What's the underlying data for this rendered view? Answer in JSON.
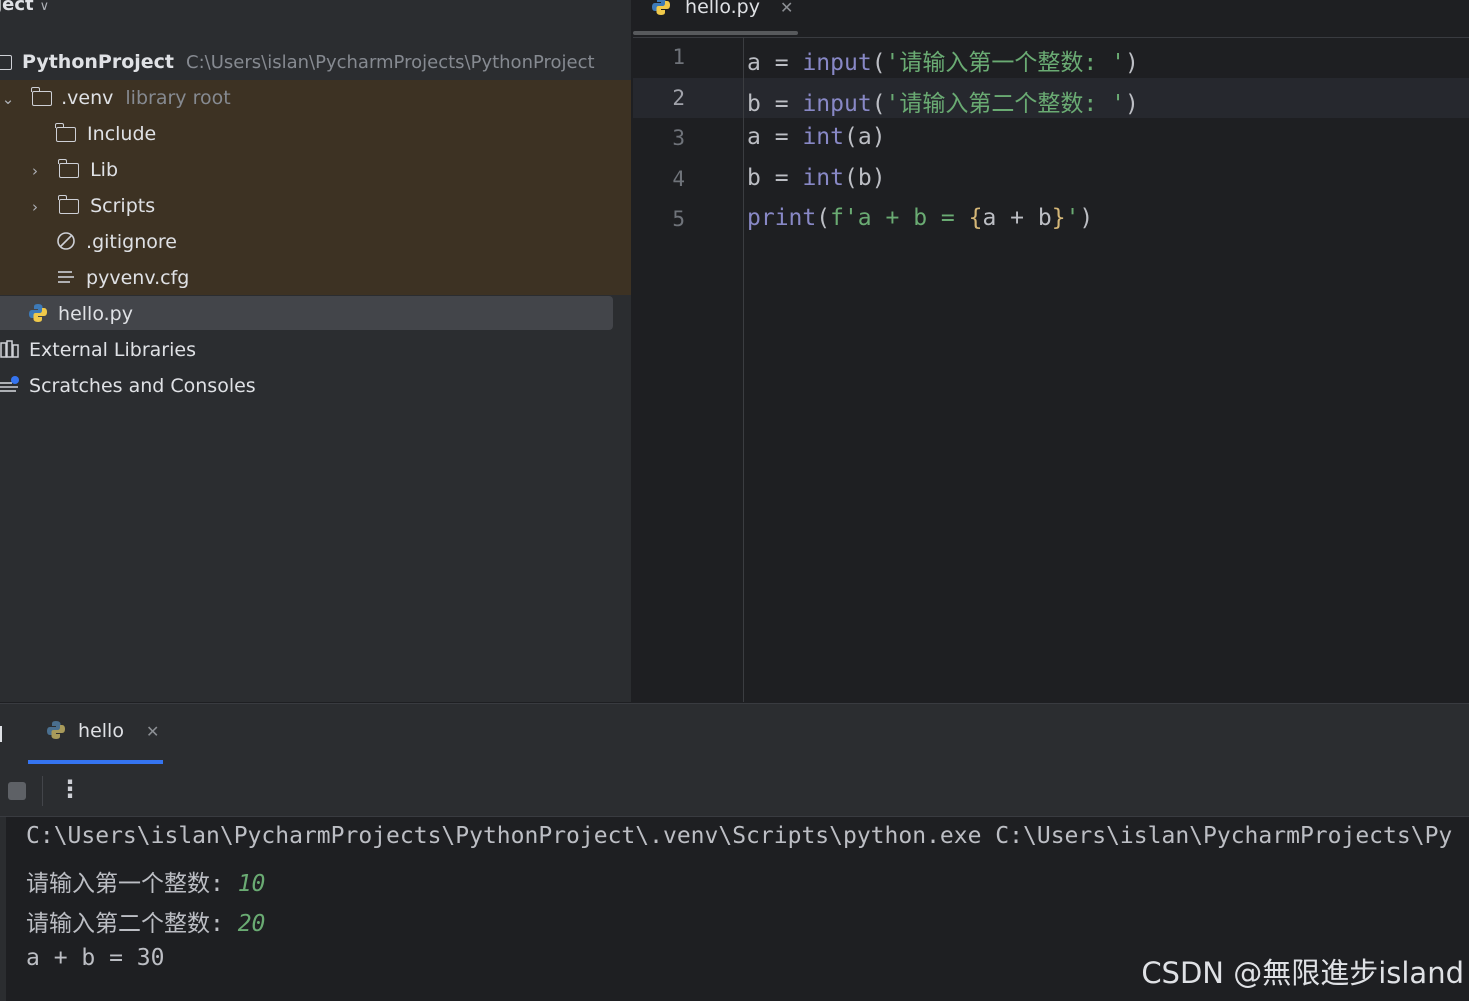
{
  "project_panel": {
    "header_label": "ject",
    "root": {
      "name": "PythonProject",
      "path": "C:\\Users\\islan\\PycharmProjects\\PythonProject"
    },
    "venv": {
      "name": ".venv",
      "note": "library root"
    },
    "items": {
      "include": "Include",
      "lib": "Lib",
      "scripts": "Scripts",
      "gitignore": ".gitignore",
      "pyvenv": "pyvenv.cfg",
      "hello": "hello.py",
      "external": "External Libraries",
      "scratches": "Scratches and Consoles"
    }
  },
  "editor": {
    "tab_label": "hello.py",
    "line_numbers": [
      "1",
      "2",
      "3",
      "4",
      "5"
    ],
    "code": {
      "l1": {
        "var": "a",
        "eq": "=",
        "fn": "input",
        "open": "(",
        "str": "'请输入第一个整数: '",
        "close": ")"
      },
      "l2": {
        "var": "b",
        "eq": "=",
        "fn": "input",
        "open": "(",
        "str": "'请输入第二个整数: '",
        "close": ")"
      },
      "l3": {
        "var": "a",
        "eq": "=",
        "fn": "int",
        "open": "(",
        "arg": "a",
        "close": ")"
      },
      "l4": {
        "var": "b",
        "eq": "=",
        "fn": "int",
        "open": "(",
        "arg": "b",
        "close": ")"
      },
      "l5": {
        "fn": "print",
        "open": "(",
        "str_start": "f'a + b = ",
        "brace_open": "{",
        "expr": "a + b",
        "brace_close": "}",
        "str_end": "'",
        "close": ")"
      }
    }
  },
  "run_panel": {
    "tab_label": "hello",
    "console": {
      "command": "C:\\Users\\islan\\PycharmProjects\\PythonProject\\.venv\\Scripts\\python.exe C:\\Users\\islan\\PycharmProjects\\Py",
      "prompt1": "请输入第一个整数: ",
      "input1": "10",
      "prompt2": "请输入第二个整数: ",
      "input2": "20",
      "result": "a + b = 30"
    }
  },
  "watermark": "CSDN @無限進步island"
}
